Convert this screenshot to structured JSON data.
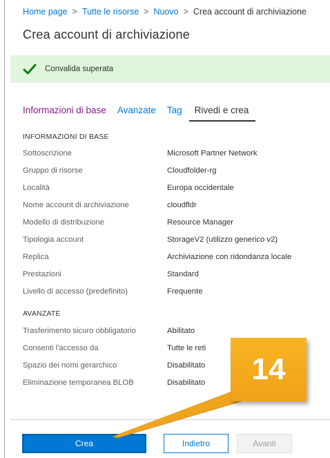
{
  "breadcrumb": [
    "Home page",
    "Tutte le risorse",
    "Nuovo",
    "Crea account di archiviazione"
  ],
  "page_title": "Crea account di archiviazione",
  "validation": {
    "message": "Convalida superata"
  },
  "tabs": [
    "Informazioni di base",
    "Avanzate",
    "Tag",
    "Rivedi e crea"
  ],
  "basics": {
    "heading": "INFORMAZIONI DI BASE",
    "rows": [
      {
        "label": "Sottoscrizione",
        "value": "Microsoft Partner Network"
      },
      {
        "label": "Gruppo di risorse",
        "value": "Cloudfolder-rg"
      },
      {
        "label": "Località",
        "value": "Europa occidentale"
      },
      {
        "label": "Nome account di archiviazione",
        "value": "cloudfldr"
      },
      {
        "label": "Modello di distribuzione",
        "value": "Resource Manager"
      },
      {
        "label": "Tipologia account",
        "value": "StorageV2 (utilizzo generico v2)"
      },
      {
        "label": "Replica",
        "value": "Archiviazione con ridondanza locale"
      },
      {
        "label": "Prestazioni",
        "value": "Standard"
      },
      {
        "label": "Livello di accesso (predefinito)",
        "value": "Frequente"
      }
    ]
  },
  "advanced": {
    "heading": "AVANZATE",
    "rows": [
      {
        "label": "Trasferimento sicuro obbligatorio",
        "value": "Abilitato"
      },
      {
        "label": "Consenti l'accesso da",
        "value": "Tutte le reti"
      },
      {
        "label": "Spazio dei nomi gerarchico",
        "value": "Disabilitato"
      },
      {
        "label": "Eliminazione temporanea BLOB",
        "value": "Disabilitato"
      }
    ]
  },
  "buttons": {
    "create": "Crea",
    "back": "Indietro",
    "next": "Avanti"
  },
  "callout": {
    "step": "14"
  },
  "colors": {
    "accent": "#0078d4",
    "success_bg": "#dff6dd",
    "success_check": "#107c10",
    "callout": "#f5a623"
  }
}
